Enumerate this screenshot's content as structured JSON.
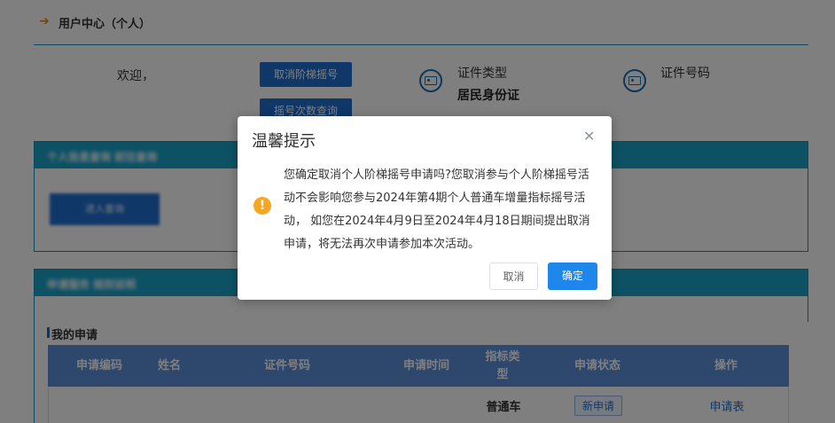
{
  "header": {
    "title": "用户中心（个人）",
    "arrow_icon": "arrow-right-icon"
  },
  "welcome": {
    "label": "欢迎，"
  },
  "buttons": {
    "cancel_lottery": "取消阶梯摇号",
    "query_count": "摇号次数查询"
  },
  "id_info": {
    "type_label": "证件类型",
    "type_value": "居民身份证",
    "number_label": "证件号码"
  },
  "sections": {
    "blurred1_title": "个人信息查询 前往查询",
    "blurred1_button": "进入查询",
    "blurred2_title": "申请服务 规则说明"
  },
  "applications": {
    "title": "我的申请",
    "columns": [
      "申请编码",
      "姓名",
      "证件号码",
      "申请时间",
      "指标类型",
      "申请状态",
      "操作"
    ],
    "rows": [
      {
        "indicator_type": "普通车",
        "status": "新申请",
        "action": "申请表"
      }
    ]
  },
  "dialog": {
    "title": "温馨提示",
    "close_icon": "close-icon",
    "warning_icon": "warning-icon",
    "message": "您确定取消个人阶梯摇号申请吗?您取消参与个人阶梯摇号活动不会影响您参与2024年第4期个人普通车增量指标摇号活动， 如您在2024年4月9日至2024年4月18日期间提出取消申请，将无法再次申请参加本次活动。",
    "cancel_label": "取消",
    "confirm_label": "确定"
  },
  "colors": {
    "accent": "#1f6fd1",
    "confirm": "#1f87ec",
    "warning": "#f5a623",
    "table_header": "#5d8fd8",
    "section_bar": "#19a2c9"
  }
}
